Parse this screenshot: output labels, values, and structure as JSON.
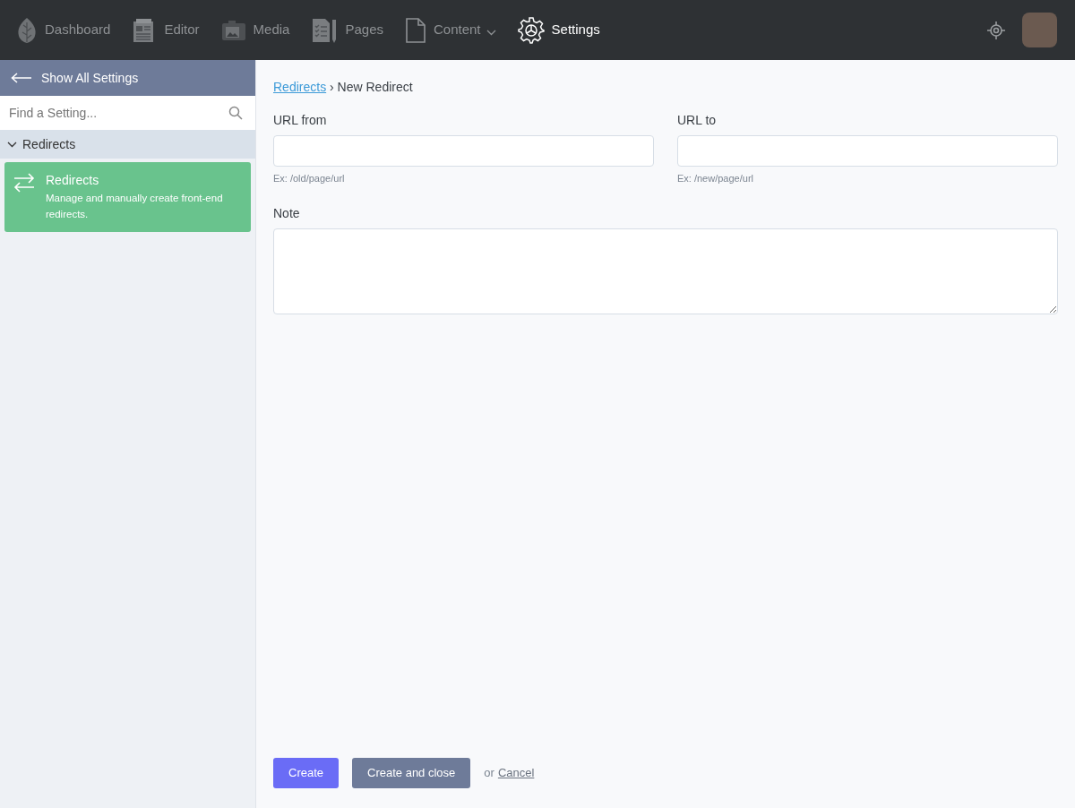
{
  "nav": {
    "items": [
      {
        "label": "Dashboard",
        "selected": false,
        "dropdown": false
      },
      {
        "label": "Editor",
        "selected": false,
        "dropdown": false
      },
      {
        "label": "Media",
        "selected": false,
        "dropdown": false
      },
      {
        "label": "Pages",
        "selected": false,
        "dropdown": false
      },
      {
        "label": "Content",
        "selected": false,
        "dropdown": true
      },
      {
        "label": "Settings",
        "selected": true,
        "dropdown": false
      }
    ]
  },
  "sidebar": {
    "back": "Show All Settings",
    "search": {
      "placeholder": "Find a Setting..."
    },
    "groups": [
      {
        "label": "Redirects",
        "expanded": true,
        "items": [
          {
            "title": "Redirects",
            "description": "Manage and manually create front-end redirects.",
            "selected": true
          }
        ]
      }
    ]
  },
  "breadcrumb": {
    "parent": "Redirects",
    "separator": "›",
    "current": "New Redirect"
  },
  "form": {
    "fields": [
      {
        "kind": "input",
        "label": "URL from",
        "hint": "Ex: /old/page/url"
      },
      {
        "kind": "input",
        "label": "URL to",
        "hint": "Ex: /new/page/url"
      },
      {
        "kind": "textarea",
        "label": "Note"
      }
    ]
  },
  "actions": {
    "primary": "Create",
    "secondary": "Create and close",
    "or": "or",
    "cancel": "Cancel"
  }
}
